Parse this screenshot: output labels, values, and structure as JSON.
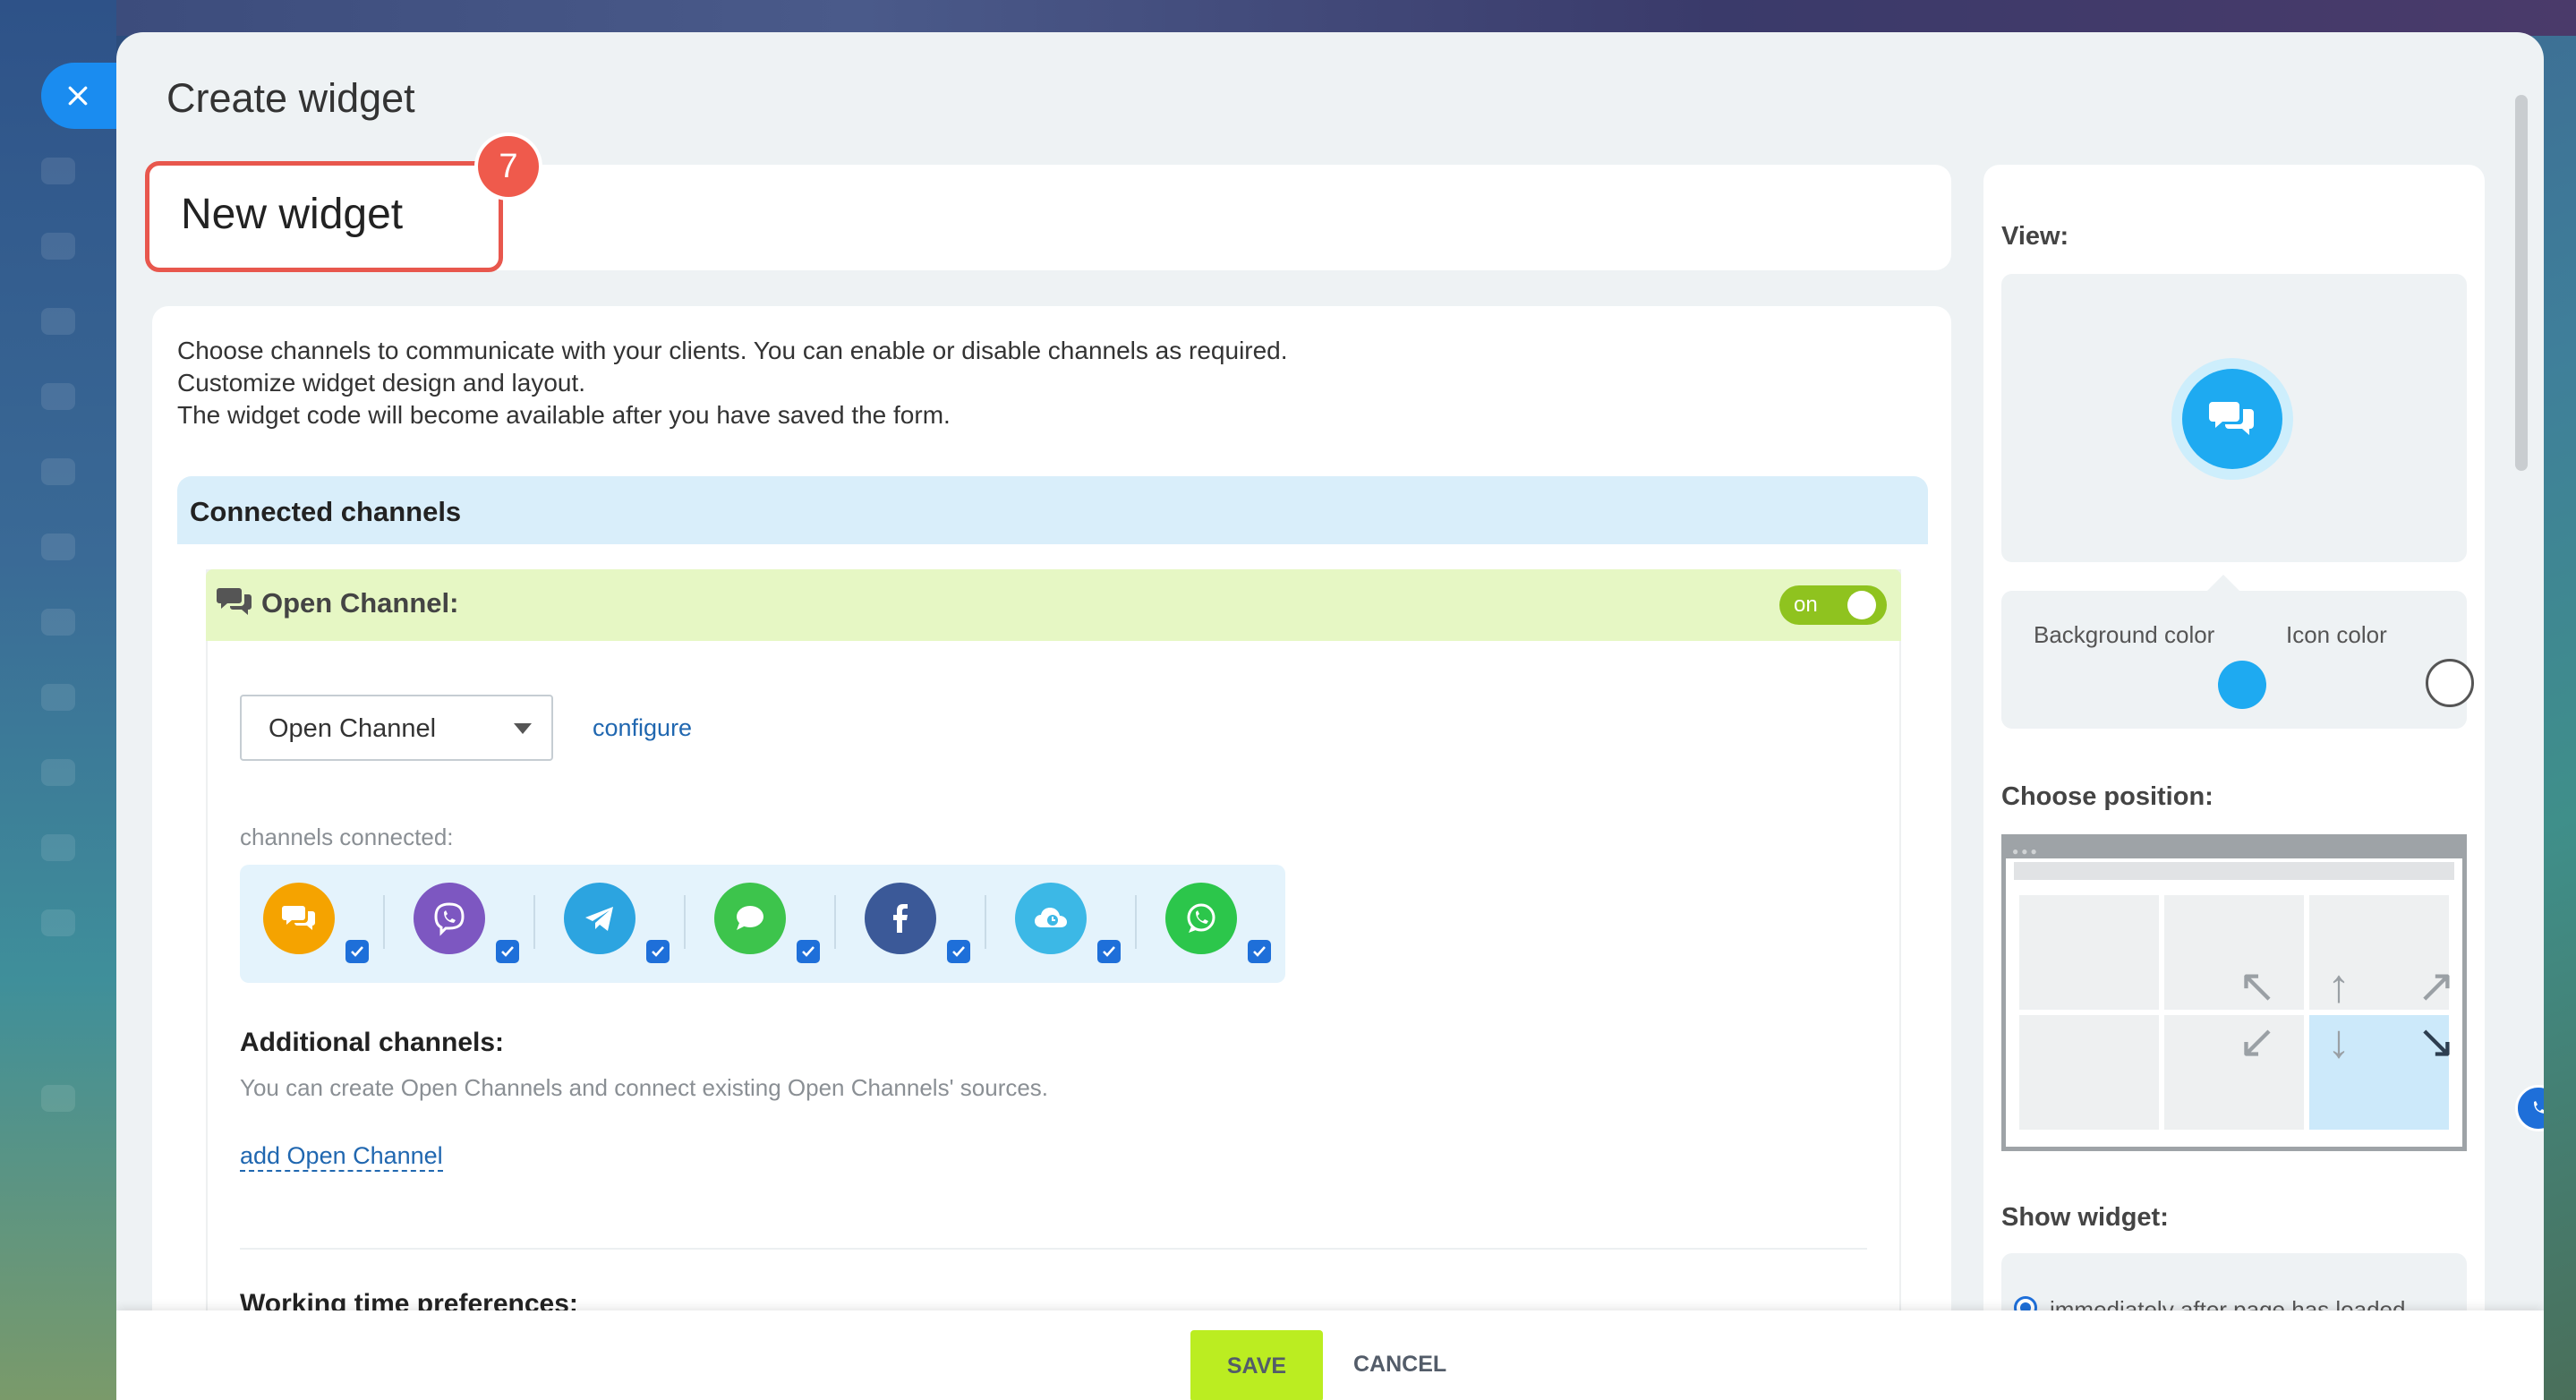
{
  "window": {
    "title": "Create widget"
  },
  "widget": {
    "name": "New widget",
    "step_badge": "7"
  },
  "intro": {
    "line1": "Choose channels to communicate with your clients. You can enable or disable channels as required.",
    "line2": "Customize widget design and layout.",
    "line3": "The widget code will become available after you have saved the form."
  },
  "connected": {
    "title": "Connected channels"
  },
  "open_channel": {
    "title": "Open Channel:",
    "toggle_label": "on",
    "toggle_state": "on",
    "select_value": "Open Channel",
    "configure_label": "configure",
    "channels_label": "channels connected:",
    "channels": [
      {
        "icon": "chat-icon",
        "color": "#f5a300",
        "checked": true
      },
      {
        "icon": "viber-icon",
        "color": "#7d57c1",
        "checked": true
      },
      {
        "icon": "telegram-icon",
        "color": "#2ca4e0",
        "checked": true
      },
      {
        "icon": "imessage-icon",
        "color": "#3dc44c",
        "checked": true
      },
      {
        "icon": "facebook-icon",
        "color": "#3b5998",
        "checked": true
      },
      {
        "icon": "cloud-icon",
        "color": "#3cb8e6",
        "checked": true
      },
      {
        "icon": "whatsapp-icon",
        "color": "#2cc64b",
        "checked": true
      }
    ]
  },
  "additional": {
    "title": "Additional channels:",
    "description": "You can create Open Channels and connect existing Open Channels' sources.",
    "add_link": "add Open Channel"
  },
  "working_time": {
    "title": "Working time preferences:"
  },
  "sidebar": {
    "view_label": "View:",
    "background_color_label": "Background color",
    "icon_color_label": "Icon color",
    "background_color": "#1eaaf1",
    "icon_color": "#ffffff",
    "position_label": "Choose position:",
    "selected_position": "bottom-right",
    "show_widget_label": "Show widget:",
    "show_option": "immediately after page has loaded"
  },
  "footer": {
    "save": "SAVE",
    "cancel": "CANCEL"
  }
}
